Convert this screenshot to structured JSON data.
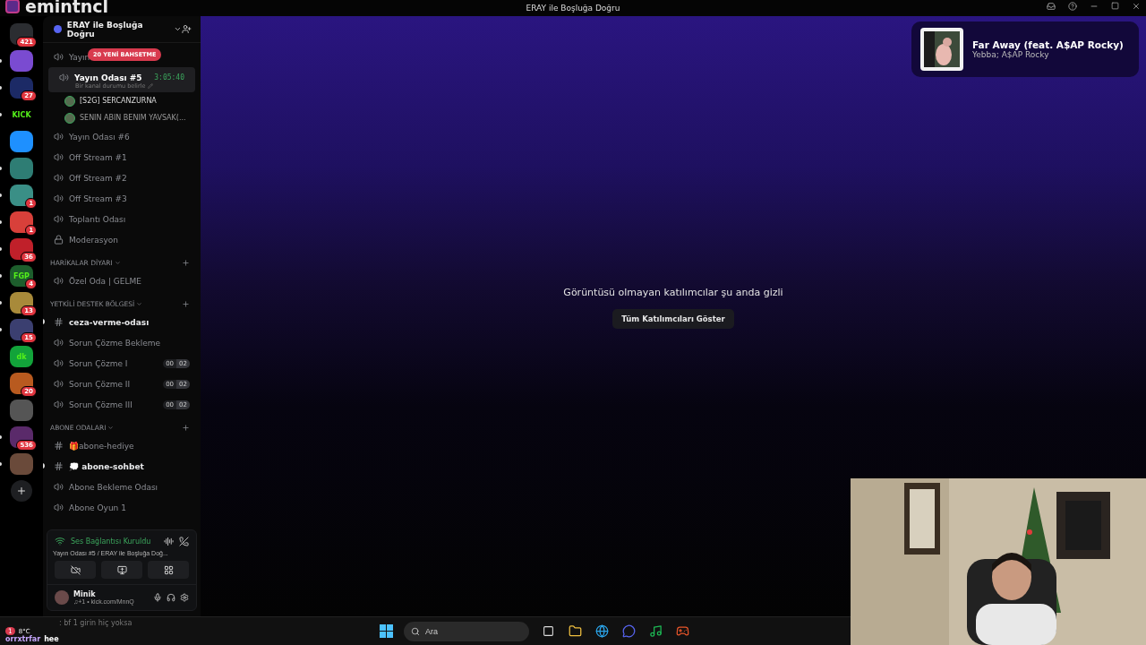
{
  "overlay_logo": "emintncl",
  "window": {
    "title": "ERAY ile Boşluğa Doğru"
  },
  "servers": [
    {
      "badge": "421",
      "color": "#2b2d31",
      "unread": false
    },
    {
      "color": "#7a4bd1",
      "unread": true
    },
    {
      "badge": "27",
      "color": "#1c2a66",
      "unread": true
    },
    {
      "label": "KICK",
      "color": "#000000",
      "unread": true
    },
    {
      "color": "#1e90ff",
      "unread": false
    },
    {
      "color": "#2e7d74",
      "unread": true
    },
    {
      "badge": "1",
      "color": "#3a8f86",
      "unread": true
    },
    {
      "badge": "1",
      "color": "#d8403a",
      "unread": true
    },
    {
      "badge": "36",
      "color": "#c0202a",
      "unread": true
    },
    {
      "label": "FGP",
      "badge": "4",
      "color": "#1d5e2c",
      "unread": true
    },
    {
      "badge": "13",
      "color": "#a88a3a",
      "unread": true
    },
    {
      "badge": "15",
      "color": "#3b3f70",
      "unread": true
    },
    {
      "label": "dk",
      "color": "#12a33a",
      "unread": false
    },
    {
      "badge": "20",
      "color": "#b85a1f",
      "unread": false
    },
    {
      "color": "#555555",
      "unread": false
    },
    {
      "badge": "536",
      "color": "#5a2a6a",
      "unread": true
    },
    {
      "color": "#6a4a3a",
      "unread": true
    }
  ],
  "server_header": {
    "name": "ERAY ile Boşluğa Doğru"
  },
  "mention_pill": "20 YENİ BAHSETME",
  "channels": [
    {
      "kind": "voice",
      "name": "Yayın",
      "selected": false,
      "unread": false
    },
    {
      "kind": "voice",
      "name": "Yayın Odası #5",
      "selected": true,
      "unread": false,
      "timer": "3:05:40",
      "status": "Bir kanal durumu belirle",
      "members": [
        "[S2G] SERCANZURNA",
        "SENIN ABIN BENIM YAVSAK(..."
      ]
    },
    {
      "kind": "voice",
      "name": "Yayın Odası #6",
      "selected": false,
      "unread": false
    },
    {
      "kind": "voice",
      "name": "Off Stream #1",
      "selected": false,
      "unread": false
    },
    {
      "kind": "voice",
      "name": "Off Stream #2",
      "selected": false,
      "unread": false
    },
    {
      "kind": "voice",
      "name": "Off Stream #3",
      "selected": false,
      "unread": false
    },
    {
      "kind": "voice",
      "name": "Toplantı Odası",
      "selected": false,
      "unread": false
    },
    {
      "kind": "locked",
      "name": "Moderasyon",
      "selected": false,
      "unread": false
    },
    {
      "kind": "category",
      "name": "HARİKALAR DİYARI"
    },
    {
      "kind": "voice",
      "name": "Özel Oda | GELME",
      "selected": false,
      "unread": false
    },
    {
      "kind": "category",
      "name": "YETKİLİ DESTEK BÖLGESİ"
    },
    {
      "kind": "text",
      "name": "ceza-verme-odası",
      "selected": false,
      "unread": true
    },
    {
      "kind": "voice",
      "name": "Sorun Çözme Bekleme",
      "selected": false,
      "unread": false
    },
    {
      "kind": "voice",
      "name": "Sorun Çözme I",
      "selected": false,
      "unread": false,
      "counter": [
        "00",
        "02"
      ]
    },
    {
      "kind": "voice",
      "name": "Sorun Çözme II",
      "selected": false,
      "unread": false,
      "counter": [
        "00",
        "02"
      ]
    },
    {
      "kind": "voice",
      "name": "Sorun Çözme III",
      "selected": false,
      "unread": false,
      "counter": [
        "00",
        "02"
      ]
    },
    {
      "kind": "category",
      "name": "ABONE ODALARI"
    },
    {
      "kind": "text",
      "name": "🎁abone-hediye",
      "selected": false,
      "unread": false
    },
    {
      "kind": "text",
      "name": "💭 abone-sohbet",
      "selected": false,
      "unread": true
    },
    {
      "kind": "voice",
      "name": "Abone Bekleme Odası",
      "selected": false,
      "unread": false
    },
    {
      "kind": "voice",
      "name": "Abone Oyun 1",
      "selected": false,
      "unread": false
    }
  ],
  "voice_panel": {
    "status": "Ses Bağlantısı Kuruldu",
    "location": "Yayın Odası #5 / ERAY ile Boşluğa Doğ..."
  },
  "user": {
    "name": "Minik",
    "activity": "♫+1 • kick.com/MnnQ"
  },
  "stage": {
    "message": "Görüntüsü olmayan katılımcılar şu anda gizli",
    "button": "Tüm Katılımcıları Göster"
  },
  "now_playing": {
    "title": "Far Away (feat. A$AP Rocky)",
    "artist": "Yebba; A$AP Rocky"
  },
  "overlay_chat": {
    "message": ": bf 1 girin hiç yoksa",
    "weather": "8°C",
    "weather_badge": "1",
    "user": "orrxtrfar",
    "text": "hee"
  },
  "taskbar": {
    "search_placeholder": "Ara"
  }
}
